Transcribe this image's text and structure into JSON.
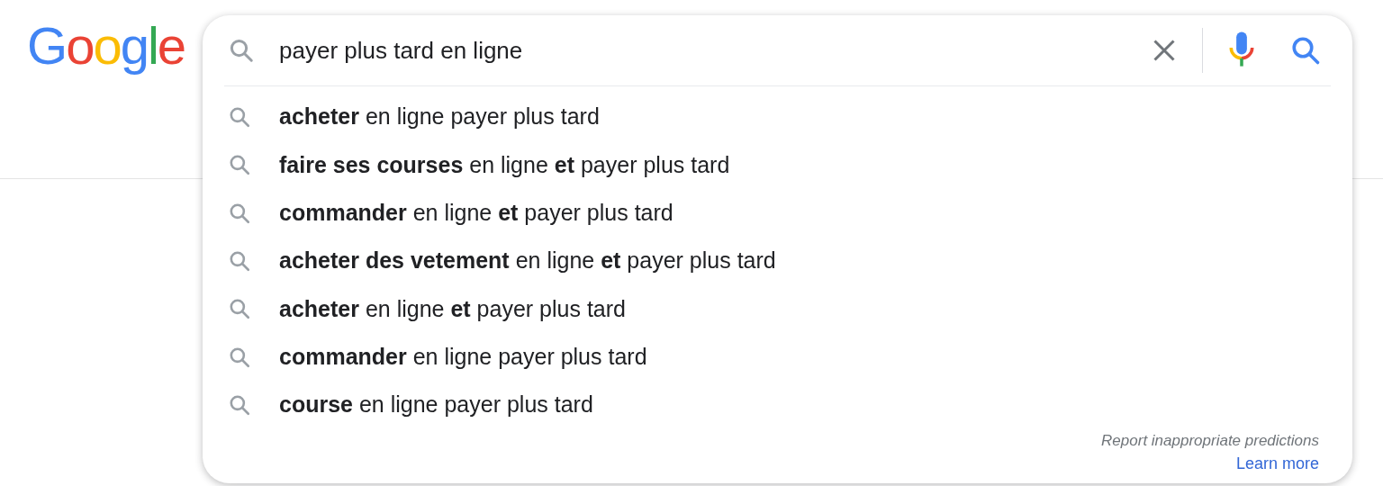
{
  "logo": {
    "text": "Google"
  },
  "search": {
    "value": "payer plus tard en ligne"
  },
  "suggestions": [
    "**acheter** en ligne payer plus tard",
    "**faire ses courses** en ligne **et** payer plus tard",
    "**commander** en ligne **et** payer plus tard",
    "**acheter des vetement** en ligne **et** payer plus tard",
    "**acheter** en ligne **et** payer plus tard",
    "**commander** en ligne payer plus tard",
    "**course** en ligne payer plus tard"
  ],
  "footer": {
    "report": "Report inappropriate predictions",
    "learn_more": "Learn more"
  }
}
